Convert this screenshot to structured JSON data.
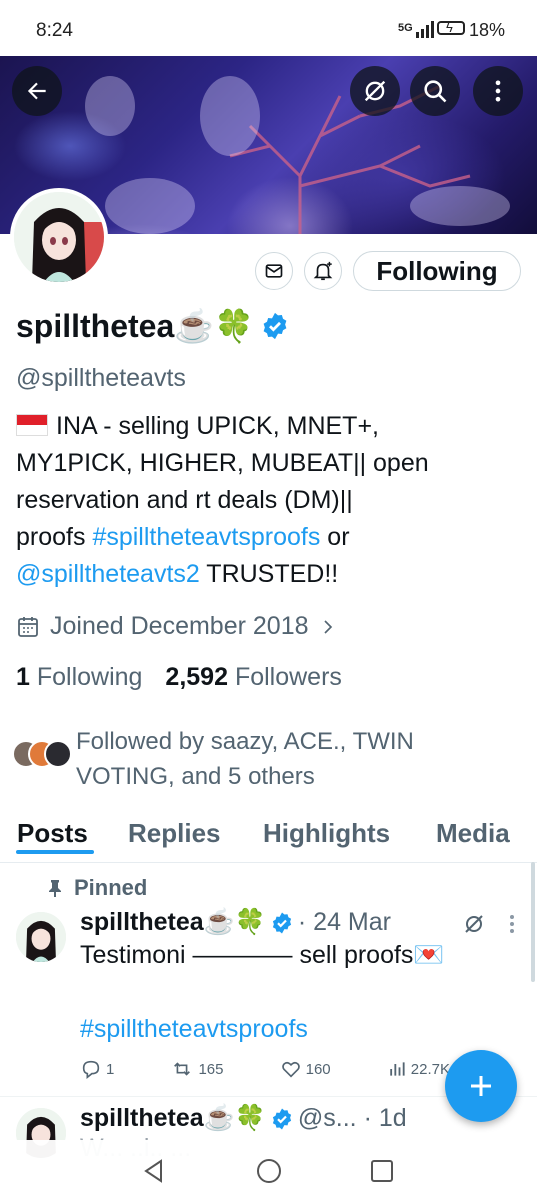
{
  "status_bar": {
    "time": "8:24",
    "network": "5G",
    "battery": "18%"
  },
  "header": {
    "back_icon": "arrow-left-icon",
    "buttons": [
      "hide-icon",
      "search-icon",
      "more-vertical-icon"
    ]
  },
  "profile": {
    "display_name": "spillthetea☕🍀",
    "handle": "@spillthetea​vts",
    "bio_line1": "INA - selling UPICK, MNET+,",
    "bio_line2": "MY1PICK, HIGHER, MUBEAT|| open",
    "bio_line3": "reservation and rt deals (DM)||",
    "bio_line4_prefix": "proofs ",
    "bio_hashtag": "#spilltheteavtsproofs",
    "bio_line4_suffix": " or",
    "bio_mention": "@spilltheteavts2",
    "bio_line5_suffix": " TRUSTED!!",
    "joined": "Joined December 2018",
    "following_count": "1",
    "following_label": "Following",
    "followers_count": "2,592",
    "followers_label": "Followers",
    "followed_by": "Followed by saazy, ACE., TWIN VOTING, and 5 others",
    "follow_button": "Following"
  },
  "tabs": [
    "Posts",
    "Replies",
    "Highlights",
    "Media"
  ],
  "posts": [
    {
      "pinned_label": "Pinned",
      "name": "spillthetea☕🍀",
      "meta": "· 24 Mar",
      "text_line1": "Testimoni ———— sell proofs💌",
      "hashtag": "#spilltheteavtsproofs",
      "replies": "1",
      "reposts": "165",
      "likes": "160",
      "views": "22.7K"
    },
    {
      "name": "spillthetea☕🍀",
      "meta": "@s...  · 1d",
      "text_line1": "W... ..i.. ..."
    }
  ],
  "colors": {
    "accent": "#1d9bf0",
    "text": "#0f1419",
    "muted": "#536471"
  }
}
